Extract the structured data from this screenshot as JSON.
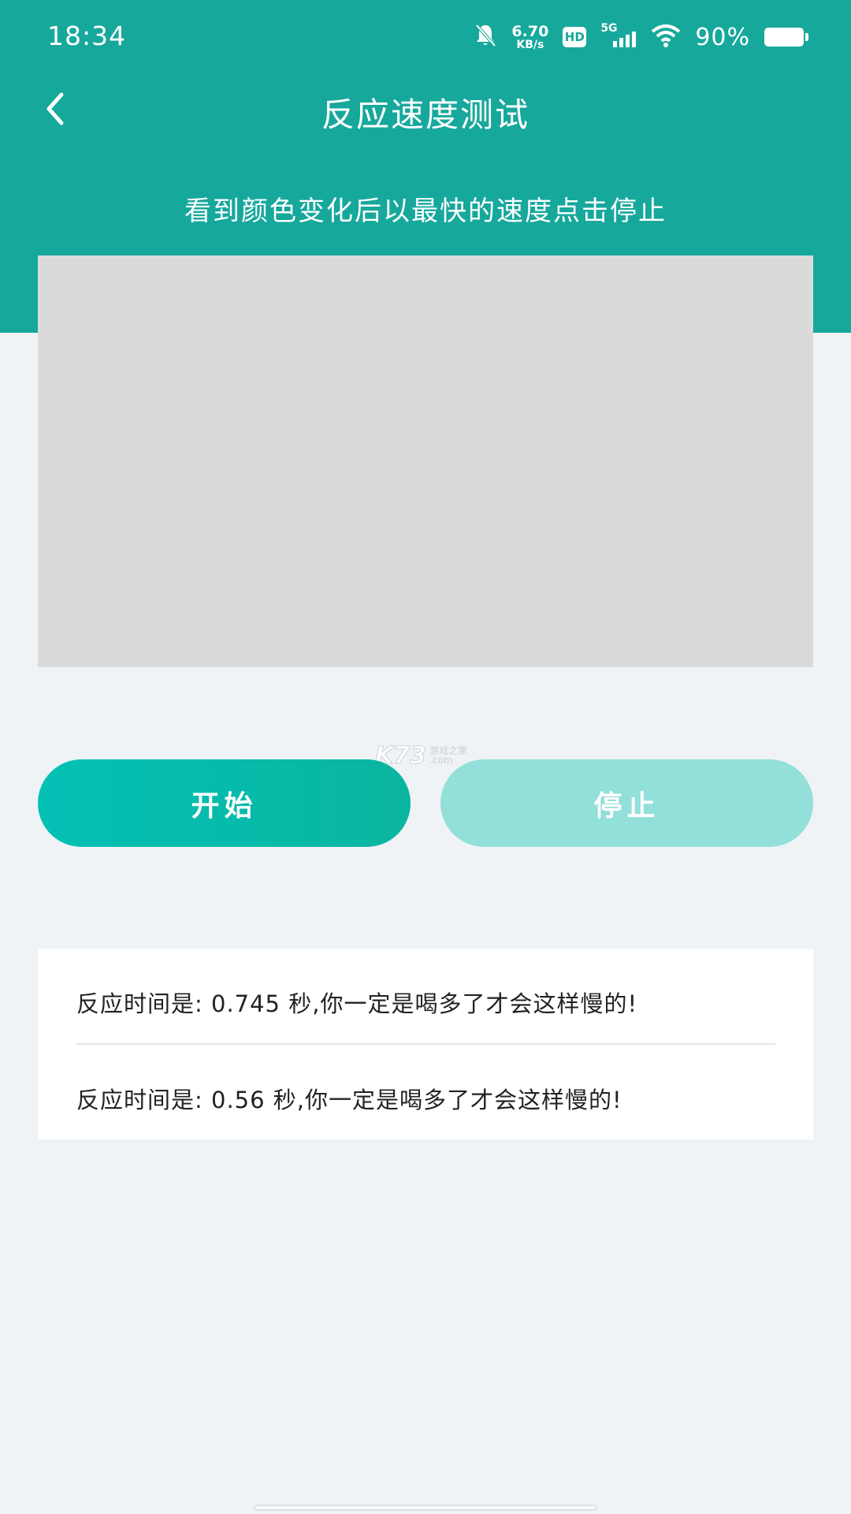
{
  "status_bar": {
    "time": "18:34",
    "net_speed_value": "6.70",
    "net_speed_unit": "KB/s",
    "hd_label": "HD",
    "network_type": "5G",
    "battery_percent": "90%",
    "icons": [
      "bell-off-icon",
      "signal-icon",
      "wifi-icon",
      "battery-icon"
    ]
  },
  "header": {
    "title": "反应速度测试",
    "back_icon": "chevron-left-icon"
  },
  "instruction": "看到颜色变化后以最快的速度点击停止",
  "buttons": {
    "start_label": "开始",
    "stop_label": "停止"
  },
  "results": [
    "反应时间是: 0.745 秒,你一定是喝多了才会这样慢的!",
    "反应时间是: 0.56 秒,你一定是喝多了才会这样慢的!"
  ],
  "watermark": {
    "main": "K73",
    "sub_top": "游戏之家",
    "sub_bottom": ".com"
  },
  "colors": {
    "header_bg": "#17a89c",
    "test_area": "#dadada",
    "start_button": "#04c1b5",
    "stop_button": "#93dfd9",
    "page_bg": "#eff3f6"
  }
}
